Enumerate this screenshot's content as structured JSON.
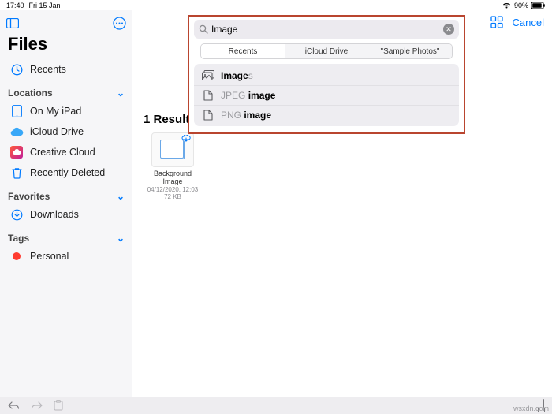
{
  "status": {
    "time": "17:40",
    "date": "Fri 15 Jan",
    "wifi": "wifi-icon",
    "battery_pct": "90%"
  },
  "sidebar": {
    "title": "Files",
    "recents": "Recents",
    "sections": {
      "locations": {
        "label": "Locations",
        "items": [
          {
            "icon": "ipad-icon",
            "label": "On My iPad"
          },
          {
            "icon": "icloud-icon",
            "label": "iCloud Drive"
          },
          {
            "icon": "creative-cloud-icon",
            "label": "Creative Cloud"
          },
          {
            "icon": "trash-icon",
            "label": "Recently Deleted"
          }
        ]
      },
      "favorites": {
        "label": "Favorites",
        "items": [
          {
            "icon": "download-icon",
            "label": "Downloads"
          }
        ]
      },
      "tags": {
        "label": "Tags",
        "items": [
          {
            "icon": "red-tag",
            "label": "Personal"
          }
        ]
      }
    }
  },
  "topbar": {
    "grid_icon": "grid-icon",
    "cancel": "Cancel"
  },
  "search": {
    "value": "Image",
    "placeholder": "Search",
    "scopes": [
      "Recents",
      "iCloud Drive",
      "\"Sample Photos\""
    ],
    "selected_scope": 0,
    "suggestions": [
      {
        "icon": "images-stack-icon",
        "prefix": "Image",
        "suffix": "s"
      },
      {
        "icon": "file-icon",
        "prefix": "JPEG ",
        "match": "image"
      },
      {
        "icon": "file-icon",
        "prefix": "PNG ",
        "match": "image"
      }
    ]
  },
  "results": {
    "heading": "1 Result",
    "items": [
      {
        "name_line1": "Background",
        "name_line2": "Image",
        "date": "04/12/2020, 12:03",
        "size": "72 KB",
        "cloud": true
      }
    ]
  },
  "watermark": "wsxdn.com"
}
